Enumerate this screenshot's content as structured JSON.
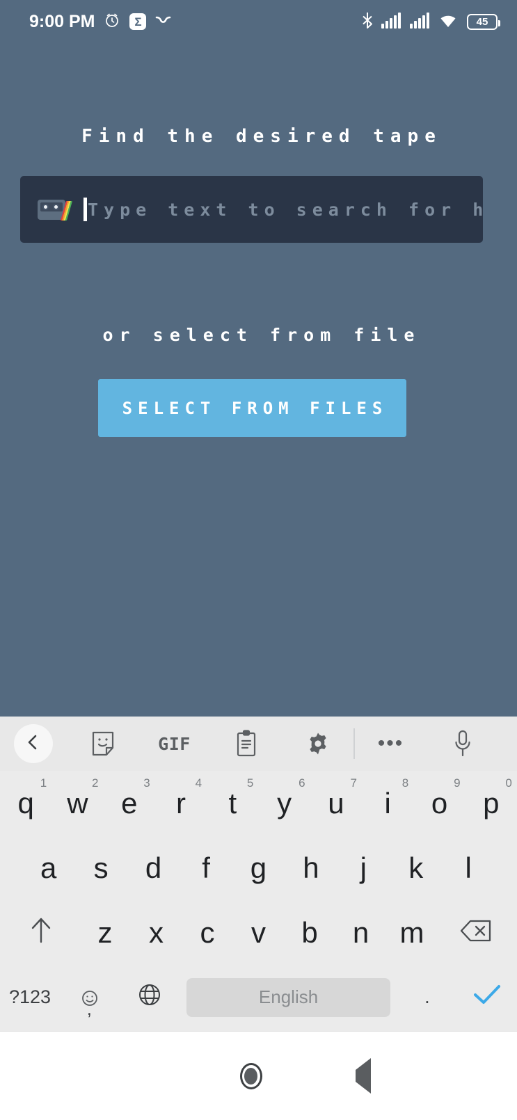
{
  "status_bar": {
    "time": "9:00 PM",
    "left_icons": [
      "alarm-clock-icon",
      "sigma-badge-icon",
      "chevron-v-icon"
    ],
    "sigma_glyph": "Σ",
    "right_icons": [
      "bluetooth-icon",
      "signal-sim1-icon",
      "signal-sim2-icon",
      "wifi-icon"
    ],
    "battery_level": "45"
  },
  "app": {
    "title": "Find the desired tape",
    "search": {
      "icon": "cassette-tape-icon",
      "value": "",
      "placeholder": "Type text to search for here"
    },
    "or_label": "or select from file",
    "select_button": "SELECT FROM FILES"
  },
  "colors": {
    "background": "#546a80",
    "search_field": "#2a3547",
    "accent_button": "#62b5e0",
    "placeholder": "#7d8c9d",
    "keyboard_bg": "#ebebeb",
    "keyboard_toolbar": "#e8e8e8",
    "enter_check": "#3ca9e8"
  },
  "keyboard": {
    "toolbar": [
      {
        "name": "back-chevron-icon",
        "label": "‹"
      },
      {
        "name": "sticker-icon",
        "label": ""
      },
      {
        "name": "gif-icon",
        "label": "GIF"
      },
      {
        "name": "clipboard-icon",
        "label": ""
      },
      {
        "name": "gear-icon",
        "label": ""
      },
      {
        "name": "divider",
        "label": ""
      },
      {
        "name": "more-options-icon",
        "label": "•••"
      },
      {
        "name": "microphone-icon",
        "label": ""
      }
    ],
    "row1": [
      {
        "key": "q",
        "hint": "1"
      },
      {
        "key": "w",
        "hint": "2"
      },
      {
        "key": "e",
        "hint": "3"
      },
      {
        "key": "r",
        "hint": "4"
      },
      {
        "key": "t",
        "hint": "5"
      },
      {
        "key": "y",
        "hint": "6"
      },
      {
        "key": "u",
        "hint": "7"
      },
      {
        "key": "i",
        "hint": "8"
      },
      {
        "key": "o",
        "hint": "9"
      },
      {
        "key": "p",
        "hint": "0"
      }
    ],
    "row2": [
      "a",
      "s",
      "d",
      "f",
      "g",
      "h",
      "j",
      "k",
      "l"
    ],
    "row3": {
      "shift": "↑",
      "letters": [
        "z",
        "x",
        "c",
        "v",
        "b",
        "n",
        "m"
      ],
      "backspace": "⌫"
    },
    "row4": {
      "symbols": "?123",
      "emoji": "☺",
      "comma": ",",
      "language": "globe-icon",
      "space_label": "English",
      "period": ".",
      "enter": "✓"
    }
  },
  "nav_bar": {
    "recents": "recents-square-icon",
    "home": "home-circle-icon",
    "back": "back-triangle-icon"
  }
}
